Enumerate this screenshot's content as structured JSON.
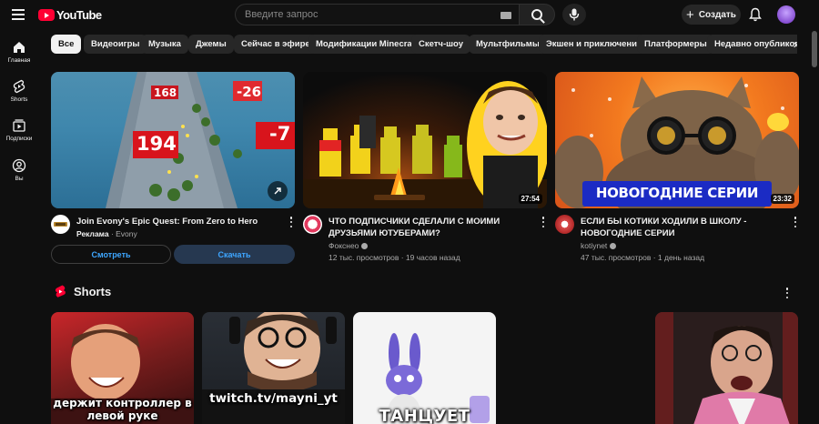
{
  "header": {
    "logo_text": "YouTube",
    "search_placeholder": "Введите запрос",
    "create_label": "Создать"
  },
  "sidebar": {
    "items": [
      {
        "label": "Главная",
        "icon": "home-icon"
      },
      {
        "label": "Shorts",
        "icon": "shorts-icon"
      },
      {
        "label": "Подписки",
        "icon": "subscriptions-icon"
      },
      {
        "label": "Вы",
        "icon": "you-icon"
      }
    ]
  },
  "chips": [
    "Все",
    "Видеоигры",
    "Музыка",
    "Джемы",
    "Сейчас в эфире",
    "Модификации Minecraft",
    "Скетч-шоу",
    "Мультфильмы",
    "Экшен и приключения",
    "Платформеры",
    "Недавно опубликованные"
  ],
  "videos": [
    {
      "title": "Join Evony's Epic Quest: From Zero to Hero",
      "line1_label": "Реклама",
      "line1_sep": " · ",
      "line1_channel": "Evony",
      "watch_label": "Смотреть",
      "download_label": "Скачать",
      "overlay_numbers": [
        "168",
        "-26",
        "194",
        "-7"
      ]
    },
    {
      "title": "ЧТО ПОДПИСЧИКИ СДЕЛАЛИ С МОИМИ ДРУЗЬЯМИ ЮТУБЕРАМИ?",
      "channel": "Фокснео",
      "stats": "12 тыс. просмотров · 19 часов назад",
      "duration": "27:54"
    },
    {
      "title": "ЕСЛИ БЫ КОТИКИ ХОДИЛИ В ШКОЛУ - НОВОГОДНИЕ СЕРИИ",
      "channel": "kotiynet",
      "stats": "47 тыс. просмотров · 1 день назад",
      "duration": "23:32",
      "banner": "НОВОГОДНИЕ СЕРИИ"
    }
  ],
  "shorts": {
    "title": "Shorts",
    "items": [
      {
        "caption": "держит контроллер в левой руке"
      },
      {
        "caption": "twitch.tv/mayni_yt"
      },
      {
        "caption": "ТАНЦУЕТ"
      },
      {
        "caption": ""
      }
    ]
  },
  "colors": {
    "background": "#0f0f0f",
    "brand_red": "#ff0033",
    "link_blue": "#3ea6ff"
  }
}
